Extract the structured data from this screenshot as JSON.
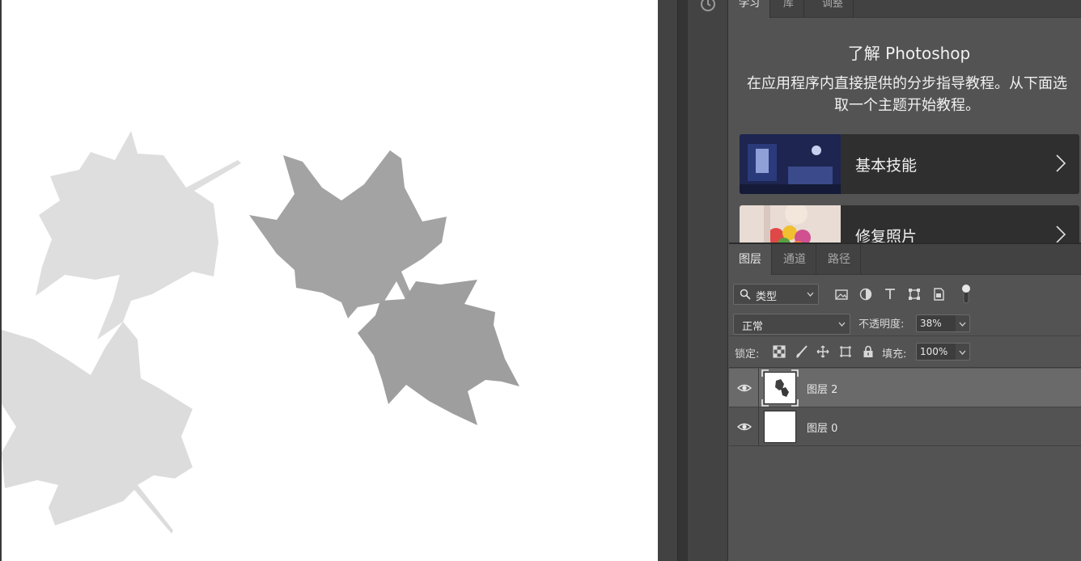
{
  "learn_panel": {
    "tabs": [
      "学习",
      "库",
      "调整"
    ],
    "title": "了解 Photoshop",
    "description": "在应用程序内直接提供的分步指导教程。从下面选取一个主题开始教程。",
    "tutorials": [
      {
        "label": "基本技能",
        "thumb": "dark-bedroom-photo"
      },
      {
        "label": "修复照片",
        "thumb": "flower-bouquet-photo"
      }
    ]
  },
  "layers_panel": {
    "tabs": [
      "图层",
      "通道",
      "路径"
    ],
    "filter": {
      "kind_label": "类型",
      "icons": [
        "image-filter-icon",
        "adjustment-filter-icon",
        "type-filter-icon",
        "shape-filter-icon",
        "smart-object-filter-icon"
      ]
    },
    "blend_mode": "正常",
    "opacity_label": "不透明度:",
    "opacity_value": "38%",
    "lock_label": "锁定:",
    "lock_icons": [
      "lock-transparent-icon",
      "lock-pixels-icon",
      "lock-position-icon",
      "lock-artboard-icon",
      "lock-all-icon"
    ],
    "fill_label": "填充:",
    "fill_value": "100%",
    "layers": [
      {
        "name": "图层 2",
        "visible": true,
        "selected": true,
        "thumb": "transparent-with-leaves"
      },
      {
        "name": "图层 0",
        "visible": true,
        "selected": false,
        "thumb": "white"
      }
    ]
  },
  "colors": {
    "panel_bg": "#535353",
    "tab_bar_bg": "#424242",
    "card_bg": "#2f2f2f",
    "selected_layer_bg": "#6a6a6a",
    "canvas_bg": "#ffffff"
  }
}
